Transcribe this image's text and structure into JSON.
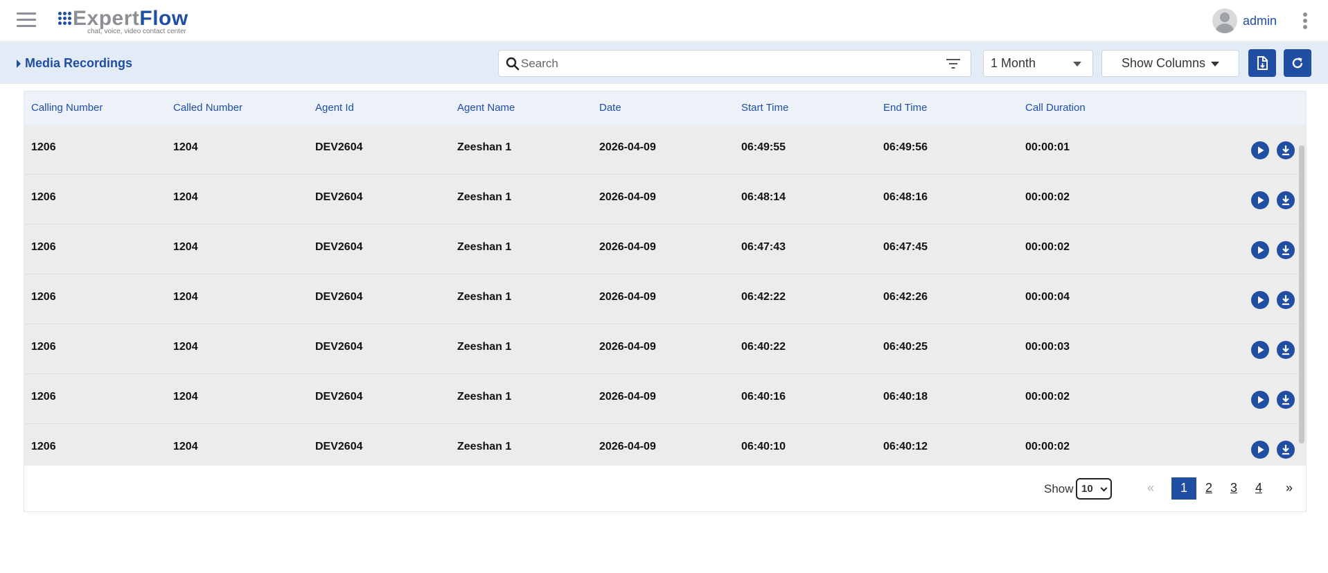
{
  "header": {
    "logo_word_1": "Expert",
    "logo_word_2": "Flow",
    "logo_tagline": "chat, voice, video contact center",
    "username": "admin"
  },
  "toolbar": {
    "breadcrumb": "Media Recordings",
    "search_placeholder": "Search",
    "period_value": "1 Month",
    "show_columns_label": "Show Columns"
  },
  "table": {
    "columns": [
      "Calling Number",
      "Called Number",
      "Agent Id",
      "Agent Name",
      "Date",
      "Start Time",
      "End Time",
      "Call Duration"
    ],
    "rows": [
      [
        "1206",
        "1204",
        "DEV2604",
        "Zeeshan 1",
        "2026-04-09",
        "06:49:55",
        "06:49:56",
        "00:00:01"
      ],
      [
        "1206",
        "1204",
        "DEV2604",
        "Zeeshan 1",
        "2026-04-09",
        "06:48:14",
        "06:48:16",
        "00:00:02"
      ],
      [
        "1206",
        "1204",
        "DEV2604",
        "Zeeshan 1",
        "2026-04-09",
        "06:47:43",
        "06:47:45",
        "00:00:02"
      ],
      [
        "1206",
        "1204",
        "DEV2604",
        "Zeeshan 1",
        "2026-04-09",
        "06:42:22",
        "06:42:26",
        "00:00:04"
      ],
      [
        "1206",
        "1204",
        "DEV2604",
        "Zeeshan 1",
        "2026-04-09",
        "06:40:22",
        "06:40:25",
        "00:00:03"
      ],
      [
        "1206",
        "1204",
        "DEV2604",
        "Zeeshan 1",
        "2026-04-09",
        "06:40:16",
        "06:40:18",
        "00:00:02"
      ],
      [
        "1206",
        "1204",
        "DEV2604",
        "Zeeshan 1",
        "2026-04-09",
        "06:40:10",
        "06:40:12",
        "00:00:02"
      ]
    ],
    "row_actions": [
      "play-icon",
      "download-icon"
    ]
  },
  "pagination": {
    "show_label": "Show",
    "page_size": "10",
    "prev": "«",
    "next": "»",
    "pages": [
      "1",
      "2",
      "3",
      "4"
    ],
    "current_page": "1"
  },
  "colors": {
    "brand": "#1f4ea3",
    "subheader_bg": "#e3ebf6",
    "row_bg": "#ececec"
  }
}
